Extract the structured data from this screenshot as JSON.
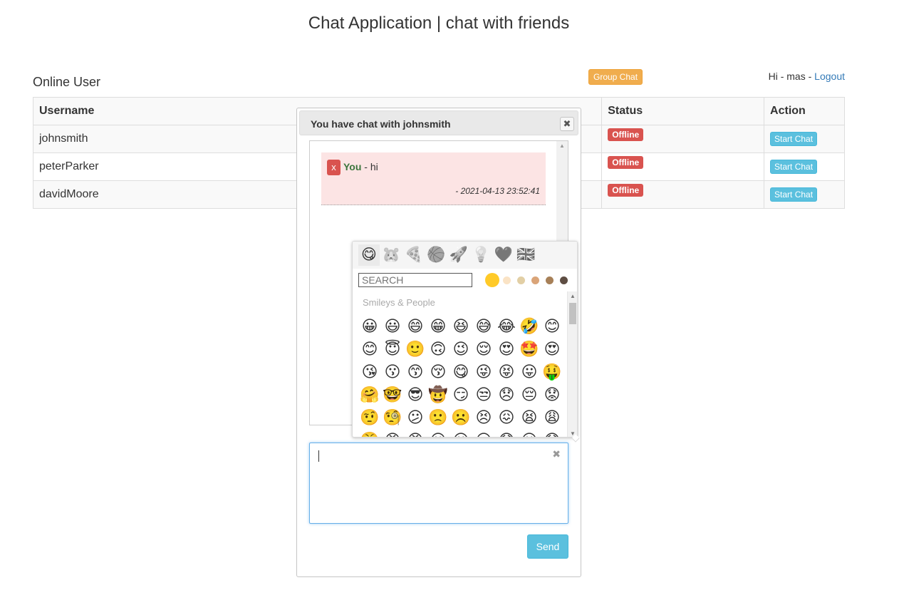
{
  "header": {
    "title": "Chat Application | chat with friends"
  },
  "section_title": "Online User",
  "group_chat_label": "Group Chat",
  "user_bar": {
    "greeting": "Hi - mas -",
    "logout_label": "Logout"
  },
  "table": {
    "headers": [
      "Username",
      "Status",
      "Action"
    ],
    "rows": [
      {
        "username": "johnsmith",
        "status": "Offline",
        "action": "Start Chat"
      },
      {
        "username": "peterParker",
        "status": "Offline",
        "action": "Start Chat"
      },
      {
        "username": "davidMoore",
        "status": "Offline",
        "action": "Start Chat"
      }
    ]
  },
  "dialog": {
    "title": "You have chat with johnsmith",
    "close_icon": "✖",
    "messages": [
      {
        "delete_label": "x",
        "sender": "You",
        "text": "- hi",
        "time": "- 2021-04-13 23:52:41"
      }
    ],
    "compose_clear_icon": "✖",
    "send_label": "Send"
  },
  "emoji_picker": {
    "tabs": [
      "😋",
      "🐹",
      "🍕",
      "🏀",
      "🚀",
      "💡",
      "🖤",
      "🇬🇧"
    ],
    "search_placeholder": "SEARCH",
    "skin_tones": [
      "#ffca28",
      "#fae3c5",
      "#e2cfa5",
      "#daa478",
      "#a78058",
      "#5e4d43"
    ],
    "category": "Smileys & People",
    "emojis": [
      "😀",
      "😃",
      "😄",
      "😁",
      "😆",
      "😅",
      "😂",
      "🤣",
      "😊",
      "😊",
      "😇",
      "🙂",
      "🙃",
      "😉",
      "😌",
      "😍",
      "🤩",
      "😍",
      "😘",
      "😗",
      "😙",
      "😚",
      "😋",
      "😜",
      "😝",
      "😛",
      "🤑",
      "🤗",
      "🤓",
      "😎",
      "🤠",
      "😏",
      "😒",
      "😞",
      "😔",
      "😟",
      "🤨",
      "🧐",
      "😕",
      "🙁",
      "☹️",
      "😣",
      "😖",
      "😫",
      "😩",
      "😤",
      "😠",
      "😡",
      "😶",
      "😐",
      "😑",
      "😯",
      "😦",
      "😧"
    ]
  }
}
